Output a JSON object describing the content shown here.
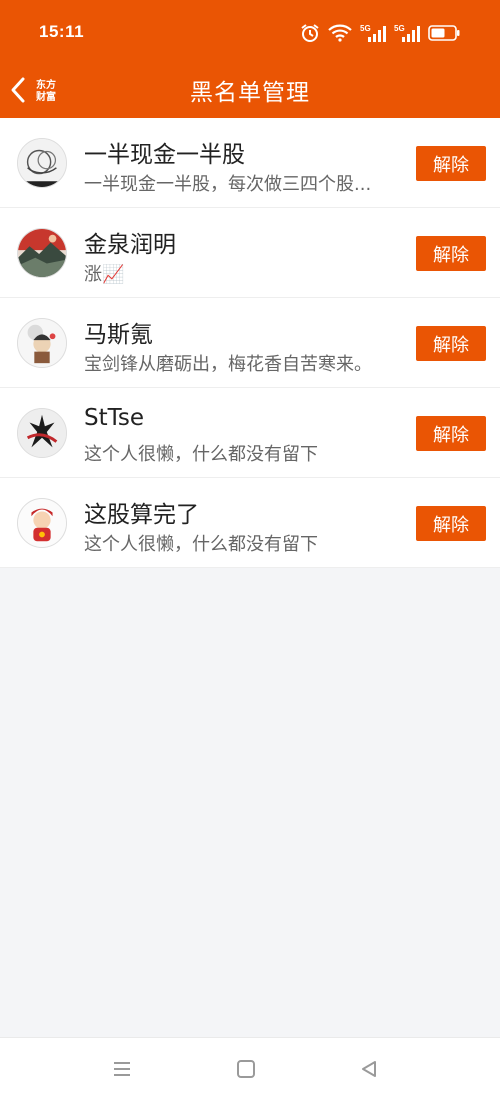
{
  "status": {
    "time": "15:11",
    "icons": [
      "alarm-icon",
      "wifi-icon",
      "signal-5g-icon",
      "signal-5g-icon",
      "battery-icon"
    ],
    "signal_label": "5G"
  },
  "header": {
    "title": "黑名单管理",
    "back_icon": "chevron-left-icon",
    "logo_line1": "东方",
    "logo_line2": "财富",
    "color": "#ea5504"
  },
  "blocked_users": [
    {
      "name": "一半现金一半股",
      "desc": "一半现金一半股，每次做三四个股...",
      "button": "解除"
    },
    {
      "name": "金泉润明",
      "desc": "涨📈",
      "button": "解除"
    },
    {
      "name": "马斯氪",
      "desc": "宝剑锋从磨砺出，梅花香自苦寒来。",
      "button": "解除"
    },
    {
      "name": "StTse",
      "desc": "这个人很懒，什么都没有留下",
      "button": "解除"
    },
    {
      "name": "这股算完了",
      "desc": "这个人很懒，什么都没有留下",
      "button": "解除"
    }
  ],
  "system_nav": [
    "menu-icon",
    "home-icon",
    "back-triangle-icon"
  ]
}
